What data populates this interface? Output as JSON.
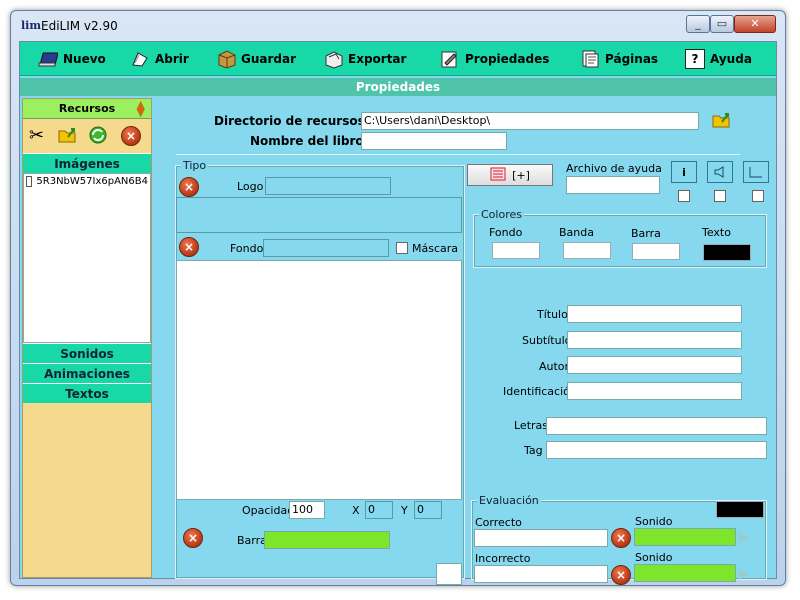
{
  "window": {
    "icon_text": "lim",
    "title": "EdiLIM  v2.90",
    "buttons": {
      "min": "_",
      "max": "▭",
      "close": "✕"
    }
  },
  "toolbar": {
    "items": [
      {
        "label": "Nuevo",
        "icon": "book-icon"
      },
      {
        "label": "Abrir",
        "icon": "open-icon"
      },
      {
        "label": "Guardar",
        "icon": "box-icon"
      },
      {
        "label": "Exportar",
        "icon": "export-icon"
      },
      {
        "label": "Propiedades",
        "icon": "properties-icon"
      },
      {
        "label": "Páginas",
        "icon": "pages-icon"
      },
      {
        "label": "Ayuda",
        "icon": "help-icon"
      }
    ]
  },
  "header": {
    "title": "Propiedades"
  },
  "sidebar": {
    "resources_label": "Recursos",
    "categories": {
      "images": "Imágenes",
      "sounds": "Sonidos",
      "animations": "Animaciones",
      "texts": "Textos"
    },
    "files": [
      "5R3NbW57Ix6pAN6B4"
    ]
  },
  "main": {
    "resources_dir_label": "Directorio de recursos",
    "resources_dir_value": "C:\\Users\\dani\\Desktop\\",
    "book_name_label": "Nombre del libro",
    "book_name_value": "",
    "tipo_title": "Tipo",
    "logo_label": "Logo",
    "fondo_label": "Fondo",
    "mascara_label": "Máscara",
    "opacidad_label": "Opacidad",
    "opacidad_value": "100",
    "x_label": "X",
    "x_value": "0",
    "y_label": "Y",
    "y_value": "0",
    "barra_label": "Barra",
    "help_button_label": "[+]",
    "help_file_label": "Archivo de ayuda",
    "colors_title": "Colores",
    "color_labels": {
      "fondo": "Fondo",
      "banda": "Banda",
      "barra": "Barra",
      "texto": "Texto"
    },
    "titulo_label": "Título",
    "subtitulo_label": "Subtítulo",
    "autor_label": "Autor",
    "identificacion_label": "Identificación",
    "letras_label": "Letras",
    "tag_label": "Tag",
    "evaluacion_title": "Evaluación",
    "correcto_label": "Correcto",
    "incorrecto_label": "Incorrecto",
    "sonido_label": "Sonido",
    "info_button": "i"
  },
  "colors": {
    "toolbar": "#18d8a8",
    "client": "#86d8ee",
    "sidebar": "#f5d98c",
    "green": "#7ee62a",
    "black": "#000000"
  }
}
